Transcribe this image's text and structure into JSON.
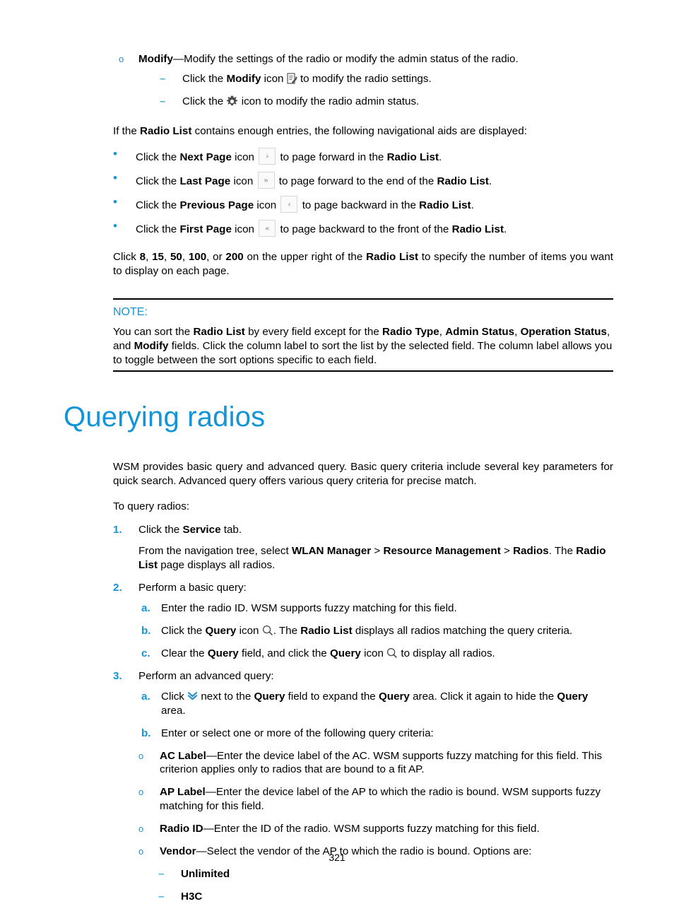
{
  "page": {
    "number": "321"
  },
  "modify_section": {
    "bullet_marker": "o",
    "term": "Modify",
    "term_rest": "—Modify the settings of the radio or modify the admin status of the radio.",
    "sub_items": [
      {
        "marker": "–",
        "pre": "Click the ",
        "bold": "Modify",
        "mid": " icon ",
        "icon": "edit-document-icon",
        "post": " to modify the radio settings."
      },
      {
        "marker": "–",
        "pre": "Click the ",
        "bold": "",
        "mid": "",
        "icon": "gear-icon",
        "post": " icon to modify the radio admin status."
      }
    ]
  },
  "nav_aids": {
    "intro_pre": "If the ",
    "intro_bold": "Radio List",
    "intro_post": " contains enough entries, the following navigational aids are displayed:",
    "items": [
      {
        "marker": "•",
        "pre": "Click the ",
        "bold": "Next Page",
        "mid": " icon ",
        "icon": "next-page-icon",
        "glyph": "›",
        "post_pre": " to page forward in the ",
        "post_bold": "Radio List",
        "post_end": "."
      },
      {
        "marker": "•",
        "pre": "Click the ",
        "bold": "Last Page",
        "mid": " icon ",
        "icon": "last-page-icon",
        "glyph": "»",
        "post_pre": " to page forward to the end of the ",
        "post_bold": "Radio List",
        "post_end": "."
      },
      {
        "marker": "•",
        "pre": "Click the ",
        "bold": "Previous Page",
        "mid": " icon ",
        "icon": "previous-page-icon",
        "glyph": "‹",
        "post_pre": " to page backward in the ",
        "post_bold": "Radio List",
        "post_end": "."
      },
      {
        "marker": "•",
        "pre": "Click the ",
        "bold": "First Page",
        "mid": " icon ",
        "icon": "first-page-icon",
        "glyph": "«",
        "post_pre": " to page backward to the front of the ",
        "post_bold": "Radio List",
        "post_end": "."
      }
    ],
    "page_size_para": {
      "pre": "Click ",
      "sizes": [
        "8",
        "15",
        "50",
        "100",
        "200"
      ],
      "mid": " on the upper right of the ",
      "bold": "Radio List",
      "post": " to specify the number of items you want to display on each page."
    }
  },
  "note": {
    "label": "NOTE:",
    "line1_pre": "You can sort the ",
    "line1_b1": "Radio List",
    "line1_mid": " by every field except for the ",
    "line1_b2": "Radio Type",
    "line1_sep1": ", ",
    "line1_b3": "Admin Status",
    "line1_sep2": ", ",
    "line1_b4": "Operation Status",
    "line1_sep3": ", and ",
    "line1_b5": "Modify",
    "line1_post": " fields. Click the column label to sort the list by the selected field. The column label allows you to toggle between the sort options specific to each field."
  },
  "heading": "Querying radios",
  "intro": {
    "para1": "WSM provides basic query and advanced query. Basic query criteria include several key parameters for quick search. Advanced query offers various query criteria for precise match.",
    "para2": "To query radios:"
  },
  "steps": [
    {
      "num": "1.",
      "pre": "Click the ",
      "bold": "Service",
      "post": " tab.",
      "detail": {
        "pre": "From the navigation tree, select ",
        "b1": "WLAN Manager",
        "sep1": " > ",
        "b2": "Resource Management",
        "sep2": " > ",
        "b3": "Radios",
        "mid": ". The ",
        "b4": "Radio List",
        "post": " page displays all radios."
      }
    },
    {
      "num": "2.",
      "text": "Perform a basic query:",
      "subs": [
        {
          "letter": "a.",
          "text": "Enter the radio ID. WSM supports fuzzy matching for this field."
        },
        {
          "letter": "b.",
          "pre": "Click the ",
          "bold": "Query",
          "mid": " icon ",
          "icon": "search-icon",
          "post_pre": ". The ",
          "post_bold": "Radio List",
          "post_end": " displays all radios matching the query criteria."
        },
        {
          "letter": "c.",
          "pre": "Clear the ",
          "bold": "Query",
          "mid": " field, and click the ",
          "bold2": "Query",
          "mid2": " icon ",
          "icon": "search-icon",
          "post_end": " to display all radios."
        }
      ]
    },
    {
      "num": "3.",
      "text": "Perform an advanced query:",
      "subs": [
        {
          "letter": "a.",
          "pre": "Click ",
          "icon": "double-chevron-down-icon",
          "mid": " next to the ",
          "bold": "Query",
          "mid2": " field to expand the ",
          "bold2": "Query",
          "mid3": " area. Click it again to hide the ",
          "bold3": "Query",
          "post_end": " area."
        },
        {
          "letter": "b.",
          "text": "Enter or select one or more of the following query criteria:"
        }
      ]
    }
  ],
  "criteria": [
    {
      "marker": "o",
      "term": "AC Label",
      "rest": "—Enter the device label of the AC. WSM supports fuzzy matching for this field. This criterion applies only to radios that are bound to a fit AP."
    },
    {
      "marker": "o",
      "term": "AP Label",
      "rest": "—Enter the device label of the AP to which the radio is bound. WSM supports fuzzy matching for this field."
    },
    {
      "marker": "o",
      "term": "Radio ID",
      "rest": "—Enter the ID of the radio. WSM supports fuzzy matching for this field."
    },
    {
      "marker": "o",
      "term": "Vendor",
      "rest": "—Select the vendor of the AP to which the radio is bound. Options are:"
    }
  ],
  "vendor_options": [
    {
      "marker": "–",
      "label": "Unlimited"
    },
    {
      "marker": "–",
      "label": "H3C"
    }
  ],
  "colors": {
    "accent_blue": "#1295d8",
    "sub_dash": "#49b3e3",
    "icon_gray": "#5a5a5a",
    "pagebtn_border": "#d7d7d7"
  }
}
